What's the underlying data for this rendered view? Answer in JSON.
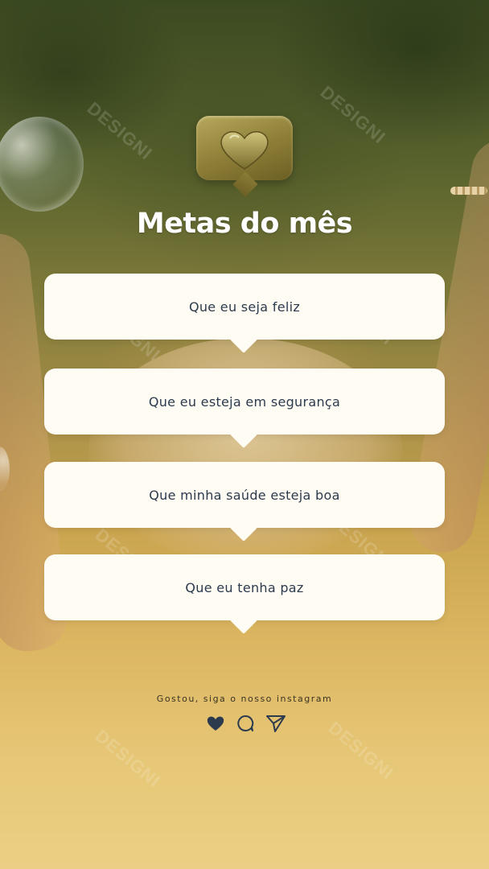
{
  "title": "Metas do mês",
  "goals": [
    {
      "text": "Que eu seja feliz"
    },
    {
      "text": "Que eu esteja em segurança"
    },
    {
      "text": "Que minha saúde esteja boa"
    },
    {
      "text": "Que eu tenha paz"
    }
  ],
  "footer": {
    "cta": "Gostou, siga o nosso instagram",
    "icons": [
      "heart-icon",
      "comment-icon",
      "send-icon"
    ]
  },
  "watermark_text": "DESIGNI",
  "colors": {
    "text_dark": "#2c3a4e",
    "card_bg": "#fffcf3",
    "title": "#ffffff",
    "badge_gold": "#8c7d36"
  }
}
